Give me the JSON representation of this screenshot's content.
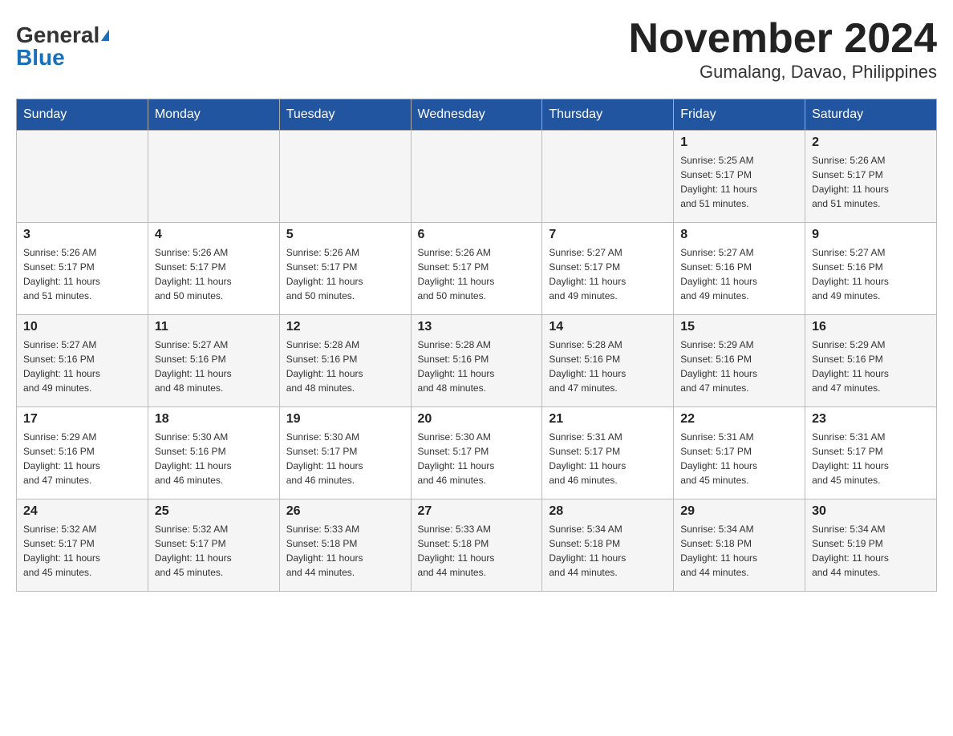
{
  "header": {
    "logo_general": "General",
    "logo_blue": "Blue",
    "title": "November 2024",
    "subtitle": "Gumalang, Davao, Philippines"
  },
  "calendar": {
    "days_of_week": [
      "Sunday",
      "Monday",
      "Tuesday",
      "Wednesday",
      "Thursday",
      "Friday",
      "Saturday"
    ],
    "weeks": [
      [
        {
          "day": "",
          "info": ""
        },
        {
          "day": "",
          "info": ""
        },
        {
          "day": "",
          "info": ""
        },
        {
          "day": "",
          "info": ""
        },
        {
          "day": "",
          "info": ""
        },
        {
          "day": "1",
          "info": "Sunrise: 5:25 AM\nSunset: 5:17 PM\nDaylight: 11 hours\nand 51 minutes."
        },
        {
          "day": "2",
          "info": "Sunrise: 5:26 AM\nSunset: 5:17 PM\nDaylight: 11 hours\nand 51 minutes."
        }
      ],
      [
        {
          "day": "3",
          "info": "Sunrise: 5:26 AM\nSunset: 5:17 PM\nDaylight: 11 hours\nand 51 minutes."
        },
        {
          "day": "4",
          "info": "Sunrise: 5:26 AM\nSunset: 5:17 PM\nDaylight: 11 hours\nand 50 minutes."
        },
        {
          "day": "5",
          "info": "Sunrise: 5:26 AM\nSunset: 5:17 PM\nDaylight: 11 hours\nand 50 minutes."
        },
        {
          "day": "6",
          "info": "Sunrise: 5:26 AM\nSunset: 5:17 PM\nDaylight: 11 hours\nand 50 minutes."
        },
        {
          "day": "7",
          "info": "Sunrise: 5:27 AM\nSunset: 5:17 PM\nDaylight: 11 hours\nand 49 minutes."
        },
        {
          "day": "8",
          "info": "Sunrise: 5:27 AM\nSunset: 5:16 PM\nDaylight: 11 hours\nand 49 minutes."
        },
        {
          "day": "9",
          "info": "Sunrise: 5:27 AM\nSunset: 5:16 PM\nDaylight: 11 hours\nand 49 minutes."
        }
      ],
      [
        {
          "day": "10",
          "info": "Sunrise: 5:27 AM\nSunset: 5:16 PM\nDaylight: 11 hours\nand 49 minutes."
        },
        {
          "day": "11",
          "info": "Sunrise: 5:27 AM\nSunset: 5:16 PM\nDaylight: 11 hours\nand 48 minutes."
        },
        {
          "day": "12",
          "info": "Sunrise: 5:28 AM\nSunset: 5:16 PM\nDaylight: 11 hours\nand 48 minutes."
        },
        {
          "day": "13",
          "info": "Sunrise: 5:28 AM\nSunset: 5:16 PM\nDaylight: 11 hours\nand 48 minutes."
        },
        {
          "day": "14",
          "info": "Sunrise: 5:28 AM\nSunset: 5:16 PM\nDaylight: 11 hours\nand 47 minutes."
        },
        {
          "day": "15",
          "info": "Sunrise: 5:29 AM\nSunset: 5:16 PM\nDaylight: 11 hours\nand 47 minutes."
        },
        {
          "day": "16",
          "info": "Sunrise: 5:29 AM\nSunset: 5:16 PM\nDaylight: 11 hours\nand 47 minutes."
        }
      ],
      [
        {
          "day": "17",
          "info": "Sunrise: 5:29 AM\nSunset: 5:16 PM\nDaylight: 11 hours\nand 47 minutes."
        },
        {
          "day": "18",
          "info": "Sunrise: 5:30 AM\nSunset: 5:16 PM\nDaylight: 11 hours\nand 46 minutes."
        },
        {
          "day": "19",
          "info": "Sunrise: 5:30 AM\nSunset: 5:17 PM\nDaylight: 11 hours\nand 46 minutes."
        },
        {
          "day": "20",
          "info": "Sunrise: 5:30 AM\nSunset: 5:17 PM\nDaylight: 11 hours\nand 46 minutes."
        },
        {
          "day": "21",
          "info": "Sunrise: 5:31 AM\nSunset: 5:17 PM\nDaylight: 11 hours\nand 46 minutes."
        },
        {
          "day": "22",
          "info": "Sunrise: 5:31 AM\nSunset: 5:17 PM\nDaylight: 11 hours\nand 45 minutes."
        },
        {
          "day": "23",
          "info": "Sunrise: 5:31 AM\nSunset: 5:17 PM\nDaylight: 11 hours\nand 45 minutes."
        }
      ],
      [
        {
          "day": "24",
          "info": "Sunrise: 5:32 AM\nSunset: 5:17 PM\nDaylight: 11 hours\nand 45 minutes."
        },
        {
          "day": "25",
          "info": "Sunrise: 5:32 AM\nSunset: 5:17 PM\nDaylight: 11 hours\nand 45 minutes."
        },
        {
          "day": "26",
          "info": "Sunrise: 5:33 AM\nSunset: 5:18 PM\nDaylight: 11 hours\nand 44 minutes."
        },
        {
          "day": "27",
          "info": "Sunrise: 5:33 AM\nSunset: 5:18 PM\nDaylight: 11 hours\nand 44 minutes."
        },
        {
          "day": "28",
          "info": "Sunrise: 5:34 AM\nSunset: 5:18 PM\nDaylight: 11 hours\nand 44 minutes."
        },
        {
          "day": "29",
          "info": "Sunrise: 5:34 AM\nSunset: 5:18 PM\nDaylight: 11 hours\nand 44 minutes."
        },
        {
          "day": "30",
          "info": "Sunrise: 5:34 AM\nSunset: 5:19 PM\nDaylight: 11 hours\nand 44 minutes."
        }
      ]
    ]
  }
}
